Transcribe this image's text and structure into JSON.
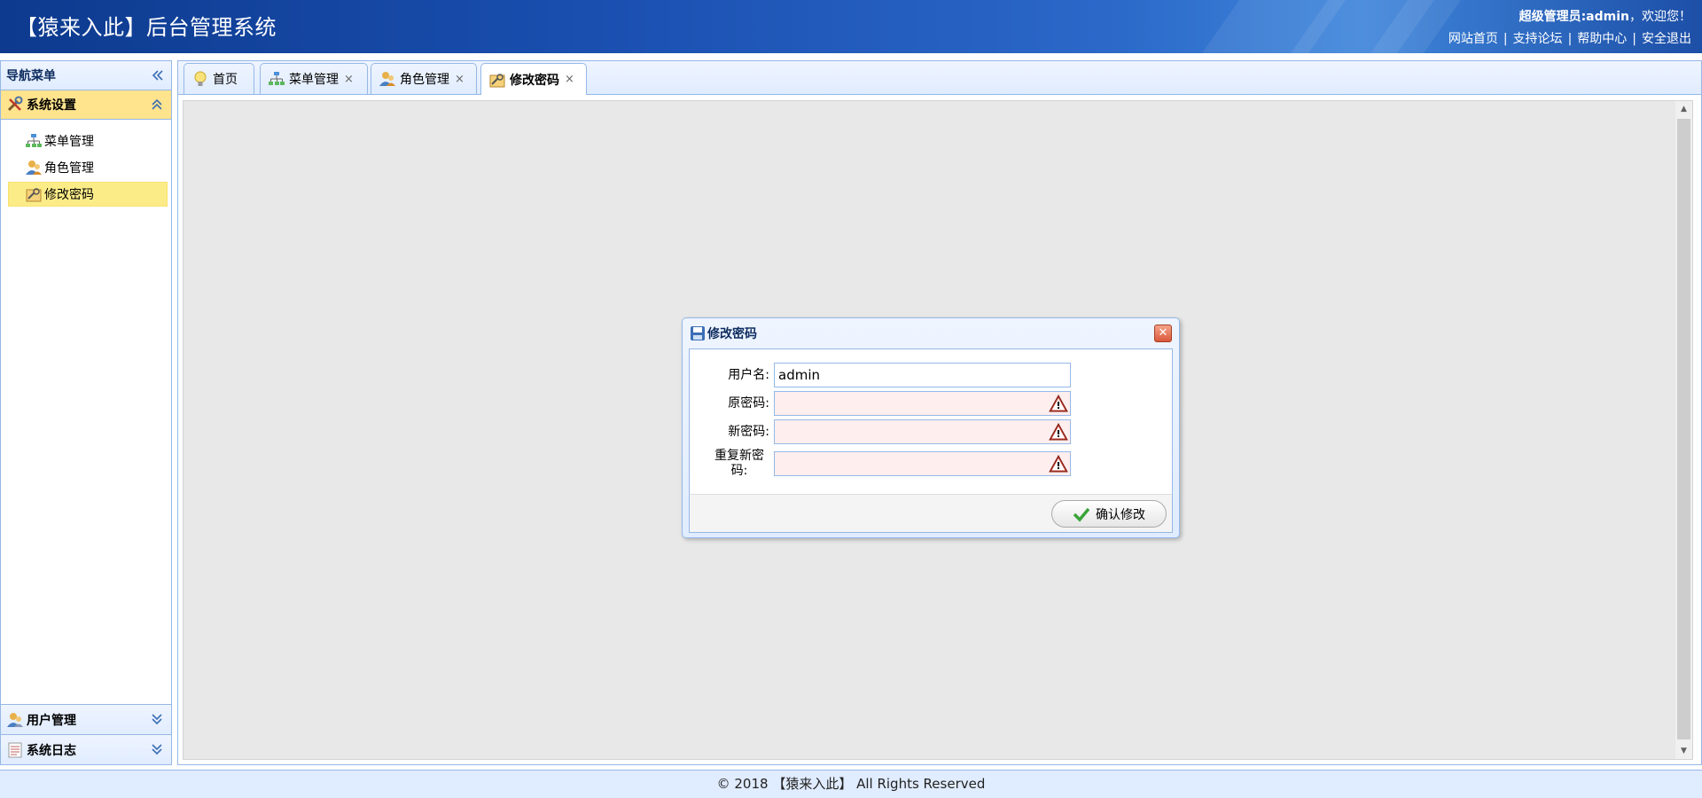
{
  "header": {
    "title": "【猿来入此】后台管理系统",
    "welcome_role": "超级管理员:admin",
    "welcome_suffix": "，欢迎您！",
    "links": [
      "网站首页",
      "支持论坛",
      "帮助中心",
      "安全退出"
    ],
    "separator": "|"
  },
  "sidebar": {
    "title": "导航菜单",
    "sections": [
      {
        "label": "系统设置",
        "icon": "tools-icon",
        "expanded": true
      },
      {
        "label": "用户管理",
        "icon": "users-icon",
        "expanded": false
      },
      {
        "label": "系统日志",
        "icon": "log-icon",
        "expanded": false
      }
    ],
    "items": [
      {
        "label": "菜单管理",
        "icon": "sitemap-icon"
      },
      {
        "label": "角色管理",
        "icon": "role-icon"
      },
      {
        "label": "修改密码",
        "icon": "password-icon",
        "active": true
      }
    ]
  },
  "tabs": [
    {
      "label": "首页",
      "icon": "lightbulb-icon",
      "closable": false
    },
    {
      "label": "菜单管理",
      "icon": "sitemap-icon",
      "closable": true
    },
    {
      "label": "角色管理",
      "icon": "role-icon",
      "closable": true
    },
    {
      "label": "修改密码",
      "icon": "password-icon",
      "closable": true,
      "active": true
    }
  ],
  "tab_close_glyph": "×",
  "dialog": {
    "title": "修改密码",
    "close_glyph": "✕",
    "fields": [
      {
        "label": "用户名:",
        "value": "admin",
        "invalid": false
      },
      {
        "label": "原密码:",
        "value": "",
        "invalid": true
      },
      {
        "label": "新密码:",
        "value": "",
        "invalid": true
      },
      {
        "label": "重复新密码:",
        "value": "",
        "invalid": true
      }
    ],
    "submit_label": "确认修改"
  },
  "footer": {
    "text": "© 2018 【猿来入此】 All Rights Reserved"
  },
  "colors": {
    "header_bg": "#1a4fb0",
    "panel_border": "#95b8e7",
    "selected_bg": "#ffe48d",
    "invalid_bg": "#ffeeee"
  }
}
